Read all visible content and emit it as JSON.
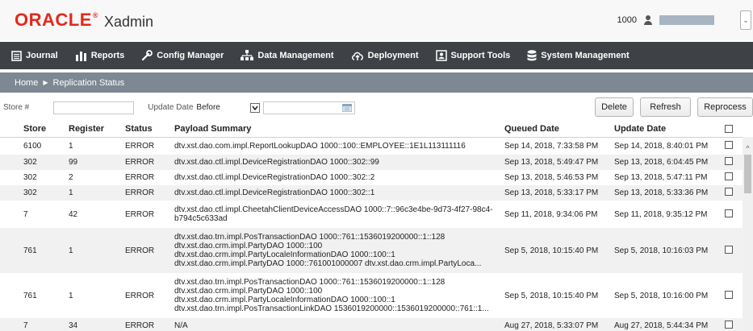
{
  "header": {
    "logo_text": "ORACLE",
    "logo_reg": "®",
    "app_name": "Xadmin",
    "store_number": "1000",
    "menu_chevron": "⌄"
  },
  "nav": {
    "items": [
      {
        "label": "Journal",
        "icon": "journal-icon"
      },
      {
        "label": "Reports",
        "icon": "reports-icon"
      },
      {
        "label": "Config Manager",
        "icon": "wrench-icon"
      },
      {
        "label": "Data Management",
        "icon": "data-management-icon"
      },
      {
        "label": "Deployment",
        "icon": "cloud-upload-icon"
      },
      {
        "label": "Support Tools",
        "icon": "support-tools-icon"
      },
      {
        "label": "System Management",
        "icon": "database-icon"
      }
    ]
  },
  "breadcrumb": {
    "home": "Home",
    "separator": "▶",
    "current": "Replication Status"
  },
  "filters": {
    "store_label": "Store #",
    "store_value": "",
    "update_date_label": "Update Date",
    "date_operator": "Before",
    "date_value": ""
  },
  "buttons": {
    "delete": "Delete",
    "refresh": "Refresh",
    "reprocess": "Reprocess"
  },
  "table": {
    "columns": {
      "store": "Store",
      "register": "Register",
      "status": "Status",
      "payload": "Payload Summary",
      "queued": "Queued Date",
      "update": "Update Date"
    },
    "rows": [
      {
        "store": "6100",
        "register": "1",
        "status": "ERROR",
        "payload": [
          "dtv.xst.dao.com.impl.ReportLookupDAO 1000::100::EMPLOYEE::1E1L113111116"
        ],
        "queued": "Sep 14, 2018, 7:33:58 PM",
        "update": "Sep 14, 2018, 8:40:01 PM"
      },
      {
        "store": "302",
        "register": "99",
        "status": "ERROR",
        "payload": [
          "dtv.xst.dao.ctl.impl.DeviceRegistrationDAO 1000::302::99"
        ],
        "queued": "Sep 13, 2018, 5:49:47 PM",
        "update": "Sep 13, 2018, 6:04:45 PM"
      },
      {
        "store": "302",
        "register": "2",
        "status": "ERROR",
        "payload": [
          "dtv.xst.dao.ctl.impl.DeviceRegistrationDAO 1000::302::2"
        ],
        "queued": "Sep 13, 2018, 5:46:53 PM",
        "update": "Sep 13, 2018, 5:47:11 PM"
      },
      {
        "store": "302",
        "register": "1",
        "status": "ERROR",
        "payload": [
          "dtv.xst.dao.ctl.impl.DeviceRegistrationDAO 1000::302::1"
        ],
        "queued": "Sep 13, 2018, 5:33:17 PM",
        "update": "Sep 13, 2018, 5:33:36 PM"
      },
      {
        "store": "7",
        "register": "42",
        "status": "ERROR",
        "payload": [
          "dtv.xst.dao.ctl.impl.CheetahClientDeviceAccessDAO 1000::7::96c3e4be-9d73-4f27-98c4-",
          "b794c5c633ad"
        ],
        "queued": "Sep 11, 2018, 9:34:06 PM",
        "update": "Sep 11, 2018, 9:35:12 PM"
      },
      {
        "store": "761",
        "register": "1",
        "status": "ERROR",
        "payload": [
          "dtv.xst.dao.trn.impl.PosTransactionDAO 1000::761::1536019200000::1::128",
          "dtv.xst.dao.crm.impl.PartyDAO 1000::100",
          "dtv.xst.dao.crm.impl.PartyLocaleInformationDAO 1000::100::1",
          "dtv.xst.dao.crm.impl.PartyDAO 1000::761001000007 dtv.xst.dao.crm.impl.PartyLoca..."
        ],
        "queued": "Sep 5, 2018, 10:15:40 PM",
        "update": "Sep 5, 2018, 10:16:03 PM"
      },
      {
        "store": "761",
        "register": "1",
        "status": "ERROR",
        "payload": [
          "dtv.xst.dao.trn.impl.PosTransactionDAO 1000::761::1536019200000::1::128",
          "dtv.xst.dao.crm.impl.PartyDAO 1000::100",
          "dtv.xst.dao.crm.impl.PartyLocaleInformationDAO 1000::100::1",
          "dtv.xst.dao.trn.impl.PosTransactionLinkDAO 1536019200000::1536019200000::761::1..."
        ],
        "queued": "Sep 5, 2018, 10:15:40 PM",
        "update": "Sep 5, 2018, 10:16:00 PM"
      },
      {
        "store": "7",
        "register": "34",
        "status": "ERROR",
        "payload": [
          "N/A"
        ],
        "queued": "Aug 27, 2018, 5:33:07 PM",
        "update": "Aug 27, 2018, 5:44:34 PM"
      }
    ]
  },
  "scrollbar": {
    "up_arrow": "^"
  },
  "colors": {
    "oracle_red": "#e3291b",
    "nav_bg": "#3e4246",
    "breadcrumb_bg": "#7d8892",
    "row_alt_bg": "#f1f1f1"
  }
}
